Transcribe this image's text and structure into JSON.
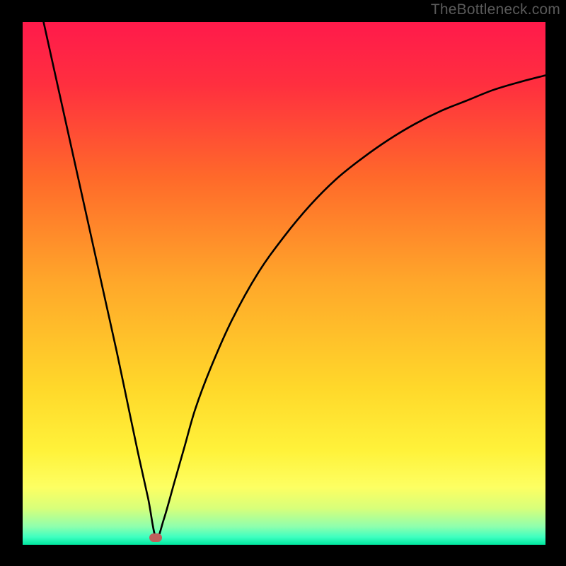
{
  "watermark": "TheBottleneck.com",
  "colors": {
    "frame": "#000000",
    "gradient_stops": [
      {
        "offset": 0.0,
        "color": "#ff1a4b"
      },
      {
        "offset": 0.12,
        "color": "#ff2f3f"
      },
      {
        "offset": 0.3,
        "color": "#ff6a2a"
      },
      {
        "offset": 0.5,
        "color": "#ffa82a"
      },
      {
        "offset": 0.7,
        "color": "#ffd82a"
      },
      {
        "offset": 0.82,
        "color": "#fff23a"
      },
      {
        "offset": 0.89,
        "color": "#fdff62"
      },
      {
        "offset": 0.93,
        "color": "#d8ff7a"
      },
      {
        "offset": 0.965,
        "color": "#8fffad"
      },
      {
        "offset": 0.985,
        "color": "#3fffc0"
      },
      {
        "offset": 1.0,
        "color": "#00e8a0"
      }
    ],
    "curve": "#000000",
    "marker": "#c0605c"
  },
  "chart_data": {
    "type": "line",
    "title": "",
    "xlabel": "",
    "ylabel": "",
    "xlim": [
      0,
      100
    ],
    "ylim": [
      0,
      100
    ],
    "marker": {
      "x": 25.5,
      "y": 1.5
    },
    "series": [
      {
        "name": "bottleneck-curve",
        "x": [
          4,
          6,
          8,
          10,
          12,
          14,
          16,
          18,
          20,
          22,
          24,
          25.5,
          27,
          29,
          31,
          33,
          36,
          40,
          45,
          50,
          55,
          60,
          65,
          70,
          75,
          80,
          85,
          90,
          95,
          100
        ],
        "y": [
          100,
          91,
          82,
          73,
          64,
          55,
          46,
          37,
          27.5,
          18,
          9,
          1.5,
          5,
          12,
          19,
          26,
          34,
          43,
          52,
          59,
          65,
          70,
          74,
          77.5,
          80.5,
          83,
          85,
          87,
          88.5,
          89.8
        ]
      }
    ]
  }
}
